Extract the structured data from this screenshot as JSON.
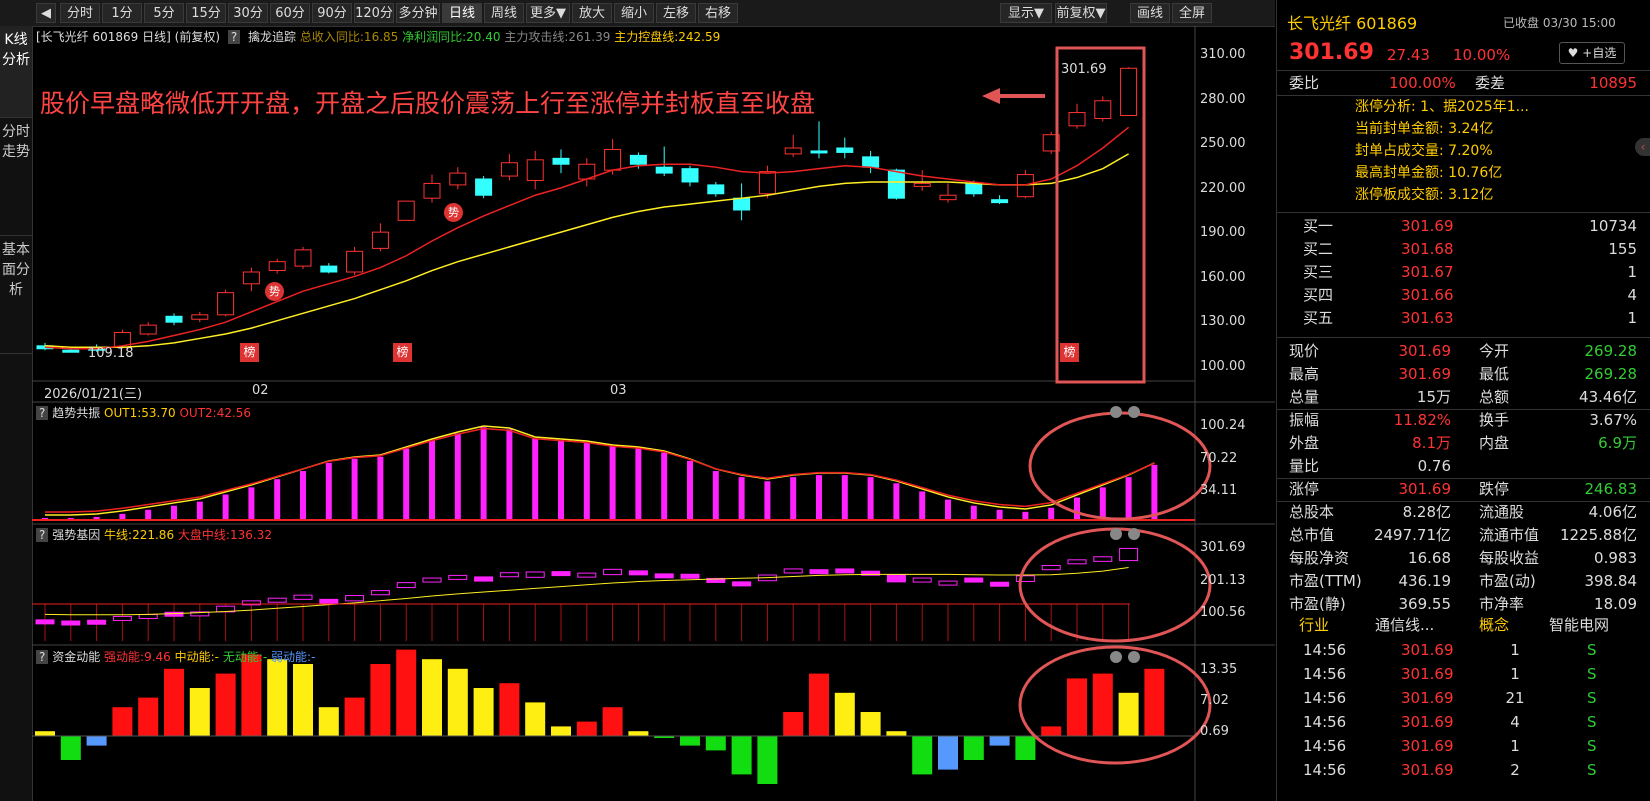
{
  "toolbar": {
    "items": [
      "分时",
      "1分",
      "5分",
      "15分",
      "30分",
      "60分",
      "90分",
      "120分",
      "多分钟",
      "日线",
      "周线",
      "更多▼",
      "放大",
      "缩小",
      "左移",
      "右移"
    ],
    "right_items": [
      "显示▼",
      "前复权▼",
      "画线",
      "全屏"
    ],
    "active": "日线"
  },
  "left_tabs": [
    "K线分析",
    "分时走势",
    "基本面分析"
  ],
  "main_info": {
    "stock": "[长飞光纤 601869 日线]",
    "adjust": "(前复权)",
    "indicator": "擒龙追踪",
    "rev_label": "总收入同比:16.85",
    "profit_label": "净利润同比:20.40",
    "attack_label": "主力攻击线:261.39",
    "control_label": "主力控盘线:242.59"
  },
  "annotation": "股价早盘略微低开开盘，开盘之后股价震荡上行至涨停并封板直至收盘",
  "price_axis": [
    "310.00",
    "280.00",
    "250.00",
    "220.00",
    "190.00",
    "160.00",
    "130.00",
    "100.00"
  ],
  "date_axis": [
    "2026/01/21(三)",
    "02",
    "03"
  ],
  "labels": {
    "high": "301.69",
    "low": "109.18",
    "bang": "榜",
    "shi": "势"
  },
  "sub1": {
    "name": "趋势共振",
    "out1": "OUT1:53.70",
    "out2": "OUT2:42.56",
    "axis": [
      "100.24",
      "70.22",
      "34.11"
    ]
  },
  "sub2": {
    "name": "强势基因",
    "niu": "牛线:221.86",
    "dapan": "大盘中线:136.32",
    "axis": [
      "301.69",
      "201.13",
      "100.56"
    ]
  },
  "sub3": {
    "name": "资金动能",
    "strong": "强动能:9.46",
    "mid": "中动能:-",
    "none": "无动能:-",
    "weak": "弱动能:-",
    "axis": [
      "13.35",
      "7.02",
      "0.69"
    ]
  },
  "right": {
    "name": "长飞光纤",
    "code": "601869",
    "status": "已收盘 03/30 15:00",
    "price": "301.69",
    "change": "27.43",
    "pct": "10.00%",
    "fav": "+自选",
    "weibi_label": "委比",
    "weibi": "100.00%",
    "weicha_label": "委差",
    "weicha": "10895",
    "limit_lines": [
      "涨停分析: 1、据2025年1...",
      "当前封单金额: 3.24亿",
      "封单占成交量: 7.20%",
      "最高封单金额: 10.76亿",
      "涨停板成交额: 3.12亿"
    ],
    "bids": [
      {
        "label": "买一",
        "price": "301.69",
        "vol": "10734"
      },
      {
        "label": "买二",
        "price": "301.68",
        "vol": "155"
      },
      {
        "label": "买三",
        "price": "301.67",
        "vol": "1"
      },
      {
        "label": "买四",
        "price": "301.66",
        "vol": "4"
      },
      {
        "label": "买五",
        "price": "301.63",
        "vol": "1"
      }
    ],
    "stats": [
      [
        "现价",
        "301.69",
        "今开",
        "269.28"
      ],
      [
        "最高",
        "301.69",
        "最低",
        "269.28"
      ],
      [
        "总量",
        "15万",
        "总额",
        "43.46亿"
      ],
      [
        "振幅",
        "11.82%",
        "换手",
        "3.67%"
      ],
      [
        "外盘",
        "8.1万",
        "内盘",
        "6.9万"
      ],
      [
        "量比",
        "0.76",
        "",
        ""
      ],
      [
        "涨停",
        "301.69",
        "跌停",
        "246.83"
      ],
      [
        "总股本",
        "8.28亿",
        "流通股",
        "4.06亿"
      ],
      [
        "总市值",
        "2497.71亿",
        "流通市值",
        "1225.88亿"
      ],
      [
        "每股净资",
        "16.68",
        "每股收益",
        "0.983"
      ],
      [
        "市盈(TTM)",
        "436.19",
        "市盈(动)",
        "398.84"
      ],
      [
        "市盈(静)",
        "369.55",
        "市净率",
        "18.09"
      ]
    ],
    "tabs": [
      "行业",
      "通信线...",
      "概念",
      "智能电网"
    ],
    "ticks": [
      {
        "time": "14:56",
        "price": "301.69",
        "vol": "1",
        "dir": "S"
      },
      {
        "time": "14:56",
        "price": "301.69",
        "vol": "1",
        "dir": "S"
      },
      {
        "time": "14:56",
        "price": "301.69",
        "vol": "21",
        "dir": "S"
      },
      {
        "time": "14:56",
        "price": "301.69",
        "vol": "4",
        "dir": "S"
      },
      {
        "time": "14:56",
        "price": "301.69",
        "vol": "1",
        "dir": "S"
      },
      {
        "time": "14:56",
        "price": "301.69",
        "vol": "2",
        "dir": "S"
      }
    ]
  },
  "chart_data": {
    "type": "candlestick",
    "candles": [
      {
        "o": 113,
        "c": 111,
        "h": 115,
        "l": 110
      },
      {
        "o": 110,
        "c": 109,
        "h": 111,
        "l": 109
      },
      {
        "o": 112,
        "c": 110,
        "h": 114,
        "l": 109
      },
      {
        "o": 112,
        "c": 122,
        "h": 124,
        "l": 111
      },
      {
        "o": 121,
        "c": 127,
        "h": 129,
        "l": 120
      },
      {
        "o": 133,
        "c": 129,
        "h": 135,
        "l": 127
      },
      {
        "o": 131,
        "c": 134,
        "h": 136,
        "l": 129
      },
      {
        "o": 134,
        "c": 149,
        "h": 151,
        "l": 133
      },
      {
        "o": 155,
        "c": 163,
        "h": 166,
        "l": 150
      },
      {
        "o": 164,
        "c": 170,
        "h": 172,
        "l": 162
      },
      {
        "o": 167,
        "c": 178,
        "h": 180,
        "l": 165
      },
      {
        "o": 167,
        "c": 163,
        "h": 169,
        "l": 162
      },
      {
        "o": 163,
        "c": 177,
        "h": 180,
        "l": 161
      },
      {
        "o": 179,
        "c": 190,
        "h": 196,
        "l": 177
      },
      {
        "o": 198,
        "c": 211,
        "h": 211,
        "l": 198
      },
      {
        "o": 213,
        "c": 223,
        "h": 229,
        "l": 210
      },
      {
        "o": 222,
        "c": 230,
        "h": 234,
        "l": 219
      },
      {
        "o": 226,
        "c": 215,
        "h": 228,
        "l": 213
      },
      {
        "o": 228,
        "c": 237,
        "h": 243,
        "l": 225
      },
      {
        "o": 225,
        "c": 239,
        "h": 245,
        "l": 219
      },
      {
        "o": 240,
        "c": 236,
        "h": 246,
        "l": 230
      },
      {
        "o": 226,
        "c": 236,
        "h": 240,
        "l": 221
      },
      {
        "o": 232,
        "c": 246,
        "h": 253,
        "l": 229
      },
      {
        "o": 242,
        "c": 236,
        "h": 244,
        "l": 233
      },
      {
        "o": 234,
        "c": 230,
        "h": 248,
        "l": 228
      },
      {
        "o": 233,
        "c": 224,
        "h": 235,
        "l": 221
      },
      {
        "o": 222,
        "c": 216,
        "h": 224,
        "l": 214
      },
      {
        "o": 213,
        "c": 205,
        "h": 223,
        "l": 198
      },
      {
        "o": 216,
        "c": 231,
        "h": 235,
        "l": 213
      },
      {
        "o": 243,
        "c": 247,
        "h": 256,
        "l": 241
      },
      {
        "o": 245,
        "c": 244,
        "h": 265,
        "l": 240
      },
      {
        "o": 247,
        "c": 244,
        "h": 254,
        "l": 240
      },
      {
        "o": 241,
        "c": 234,
        "h": 245,
        "l": 230
      },
      {
        "o": 232,
        "c": 213,
        "h": 233,
        "l": 212
      },
      {
        "o": 221,
        "c": 223,
        "h": 232,
        "l": 218
      },
      {
        "o": 212,
        "c": 215,
        "h": 223,
        "l": 210
      },
      {
        "o": 223,
        "c": 216,
        "h": 225,
        "l": 214
      },
      {
        "o": 212,
        "c": 210,
        "h": 215,
        "l": 209
      },
      {
        "o": 214,
        "c": 229,
        "h": 232,
        "l": 213
      },
      {
        "o": 245,
        "c": 256,
        "h": 258,
        "l": 243
      },
      {
        "o": 262,
        "c": 271,
        "h": 277,
        "l": 260
      },
      {
        "o": 267,
        "c": 279,
        "h": 282,
        "l": 265
      },
      {
        "o": 269,
        "c": 301,
        "h": 301.69,
        "l": 269
      }
    ],
    "ma_attack": [
      112,
      111,
      111,
      113,
      116,
      120,
      124,
      129,
      136,
      143,
      150,
      155,
      160,
      166,
      174,
      184,
      193,
      201,
      208,
      215,
      220,
      226,
      232,
      235,
      236,
      236,
      234,
      231,
      230,
      231,
      233,
      235,
      234,
      231,
      228,
      226,
      224,
      222,
      222,
      226,
      235,
      247,
      261
    ],
    "ma_control": [
      113,
      112,
      112,
      112,
      113,
      115,
      118,
      121,
      125,
      130,
      135,
      140,
      145,
      151,
      157,
      164,
      170,
      175,
      180,
      185,
      190,
      195,
      200,
      204,
      207,
      209,
      211,
      213,
      215,
      218,
      221,
      223,
      224,
      224,
      224,
      224,
      223,
      222,
      222,
      223,
      227,
      233,
      243
    ],
    "sub1_bars": [
      2,
      2,
      3,
      6,
      10,
      14,
      18,
      25,
      32,
      40,
      48,
      56,
      60,
      62,
      70,
      78,
      85,
      91,
      89,
      80,
      78,
      76,
      72,
      70,
      66,
      58,
      48,
      42,
      38,
      42,
      44,
      44,
      42,
      36,
      28,
      20,
      14,
      10,
      8,
      12,
      22,
      32,
      42,
      54
    ],
    "sub3_bars": [
      1,
      -5,
      -2,
      6,
      8,
      14,
      10,
      13,
      17,
      16,
      15,
      6,
      8,
      15,
      18,
      16,
      14,
      10,
      11,
      7,
      2,
      3,
      6,
      1,
      0,
      -2,
      -3,
      -8,
      -10,
      5,
      13,
      9,
      5,
      1,
      -8,
      -7,
      -5,
      -2,
      -5,
      2,
      12,
      13,
      9,
      14
    ],
    "sub3_colors": [
      "y",
      "g",
      "b",
      "r",
      "r",
      "r",
      "y",
      "r",
      "r",
      "y",
      "y",
      "y",
      "r",
      "r",
      "r",
      "y",
      "y",
      "y",
      "r",
      "y",
      "y",
      "r",
      "r",
      "y",
      "g",
      "g",
      "g",
      "g",
      "g",
      "r",
      "r",
      "y",
      "y",
      "y",
      "g",
      "b",
      "g",
      "b",
      "g",
      "r",
      "r",
      "r",
      "y",
      "r"
    ]
  }
}
